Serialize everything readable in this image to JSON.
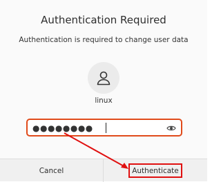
{
  "dialog": {
    "title": "Authentication Required",
    "message": "Authentication is required to change user data",
    "user": {
      "name": "linux",
      "avatar_icon": "user-avatar-icon"
    },
    "password": {
      "masked_value": "●●●●●●●●",
      "border_color": "#e04a1a"
    },
    "buttons": {
      "cancel": "Cancel",
      "authenticate": "Authenticate"
    }
  },
  "annotation": {
    "color": "#e01010"
  }
}
